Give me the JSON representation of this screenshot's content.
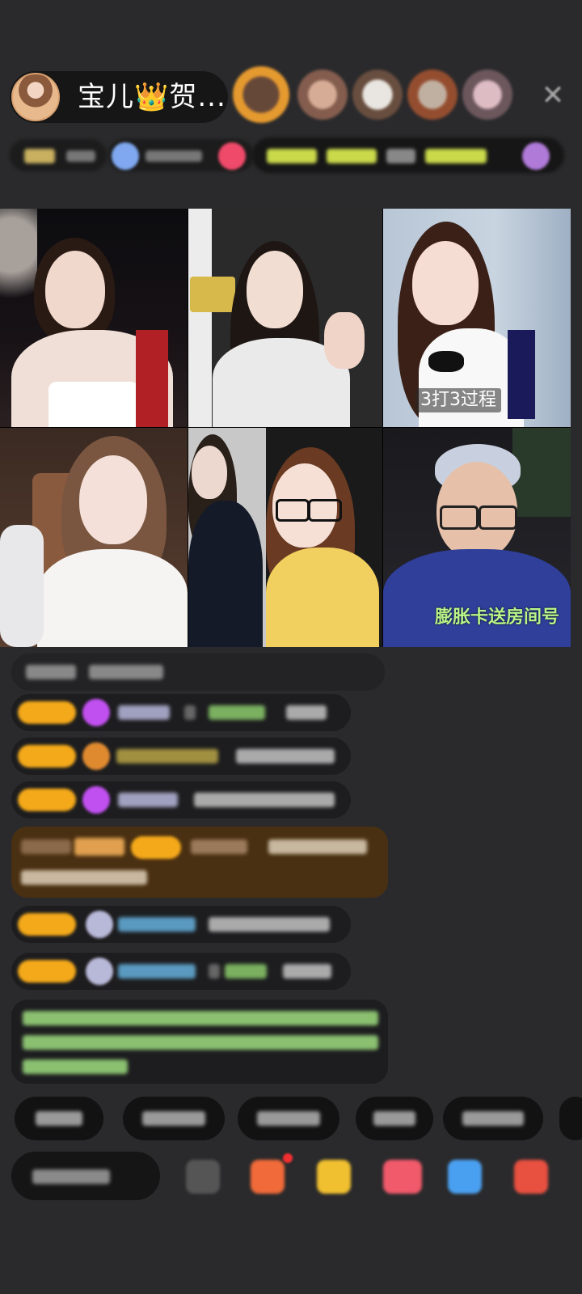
{
  "header": {
    "host_name": "宝儿👑贺...",
    "close_symbol": "✕"
  },
  "tiles": [
    {
      "caption": ""
    },
    {
      "caption": ""
    },
    {
      "caption": "3打3过程"
    },
    {
      "caption": ""
    },
    {
      "caption": ""
    },
    {
      "caption": "膨胀卡送房间号"
    }
  ],
  "colors": {
    "background": "#2a2a2c",
    "badge": "#f4a91a",
    "gift_highlight": "#4a3012"
  },
  "icons": [
    "crown-icon",
    "close-icon",
    "gem-icon",
    "gift-icon",
    "chat-icon",
    "share-icon"
  ]
}
